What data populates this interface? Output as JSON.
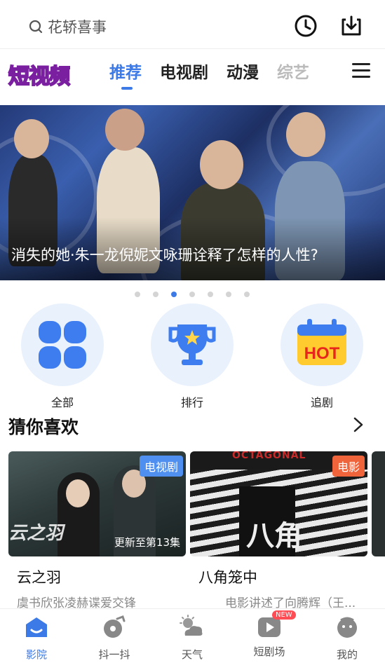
{
  "search": {
    "placeholder_text": "花轿喜事"
  },
  "header": {
    "history_icon": "clock-icon",
    "download_icon": "download-icon"
  },
  "logo": {
    "text": "短视频"
  },
  "tabs": [
    {
      "label": "推荐",
      "active": true
    },
    {
      "label": "电视剧"
    },
    {
      "label": "动漫"
    },
    {
      "label": "综艺"
    }
  ],
  "banner": {
    "title": "消失的她·朱一龙倪妮文咏珊诠释了怎样的人性?",
    "dots_total": 7,
    "dots_active_index": 2
  },
  "quick_entries": [
    {
      "label": "全部",
      "icon": "grid-icon"
    },
    {
      "label": "排行",
      "icon": "trophy-icon"
    },
    {
      "label": "追剧",
      "icon": "hot-calendar-icon",
      "badge": "HOT"
    }
  ],
  "section": {
    "title": "猜你喜欢"
  },
  "cards": [
    {
      "title": "云之羽",
      "desc": "虞书欣张凌赫谍爱交锋",
      "tag": "电视剧",
      "tag_color": "#4f8ff0",
      "update": "更新至第13集",
      "poster_text": "云之羽"
    },
    {
      "title": "八角笼中",
      "desc": "电影讲述了向腾辉（王...",
      "tag": "电影",
      "tag_color": "#f0643c",
      "poster_text": "八角",
      "poster_top_text": "OCTAGONAL"
    }
  ],
  "bottom_nav": [
    {
      "label": "影院",
      "icon": "cinema-icon",
      "active": true
    },
    {
      "label": "抖一抖",
      "icon": "shake-icon"
    },
    {
      "label": "天气",
      "icon": "weather-icon"
    },
    {
      "label": "短剧场",
      "icon": "play-icon",
      "badge": "NEW"
    },
    {
      "label": "我的",
      "icon": "profile-icon"
    }
  ],
  "colors": {
    "accent": "#3c7ae8",
    "quick_bg": "#e9f1fd"
  }
}
